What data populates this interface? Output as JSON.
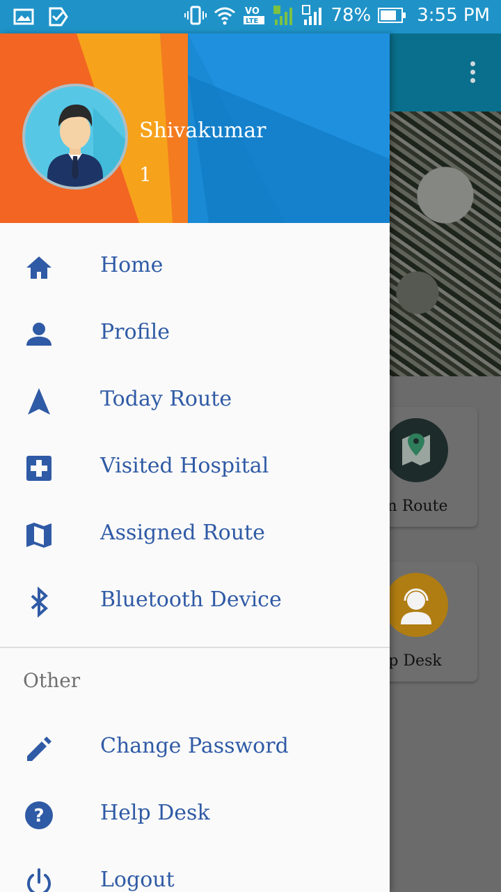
{
  "status_bar": {
    "battery": "78%",
    "time": "3:55 PM",
    "battery_level": 0.78,
    "icons": [
      "gallery-icon",
      "check-app-icon",
      "vibrate-icon",
      "wifi-icon",
      "volte-icon",
      "sim1-signal-icon",
      "sim2-signal-icon",
      "battery-icon"
    ]
  },
  "background_app": {
    "cards": [
      {
        "label": "gn Route",
        "icon": "map-pin-icon"
      },
      {
        "label": "lp Desk",
        "icon": "support-agent-icon"
      }
    ]
  },
  "drawer": {
    "user": {
      "name": "Shivakumar",
      "id": "1"
    },
    "menu": [
      {
        "label": "Home",
        "icon": "home-icon"
      },
      {
        "label": "Profile",
        "icon": "person-icon"
      },
      {
        "label": "Today Route",
        "icon": "navigation-icon"
      },
      {
        "label": "Visited Hospital",
        "icon": "hospital-icon"
      },
      {
        "label": "Assigned Route",
        "icon": "map-icon"
      },
      {
        "label": "Bluetooth Device",
        "icon": "bluetooth-icon"
      }
    ],
    "section_other": "Other",
    "other_menu": [
      {
        "label": "Change Password",
        "icon": "pencil-icon"
      },
      {
        "label": "Help Desk",
        "icon": "help-icon"
      },
      {
        "label": "Logout",
        "icon": "power-icon"
      }
    ]
  },
  "colors": {
    "status_bar": "#1f93c8",
    "menu_text": "#2f5aa5",
    "menu_icon": "#2f5aa5"
  }
}
